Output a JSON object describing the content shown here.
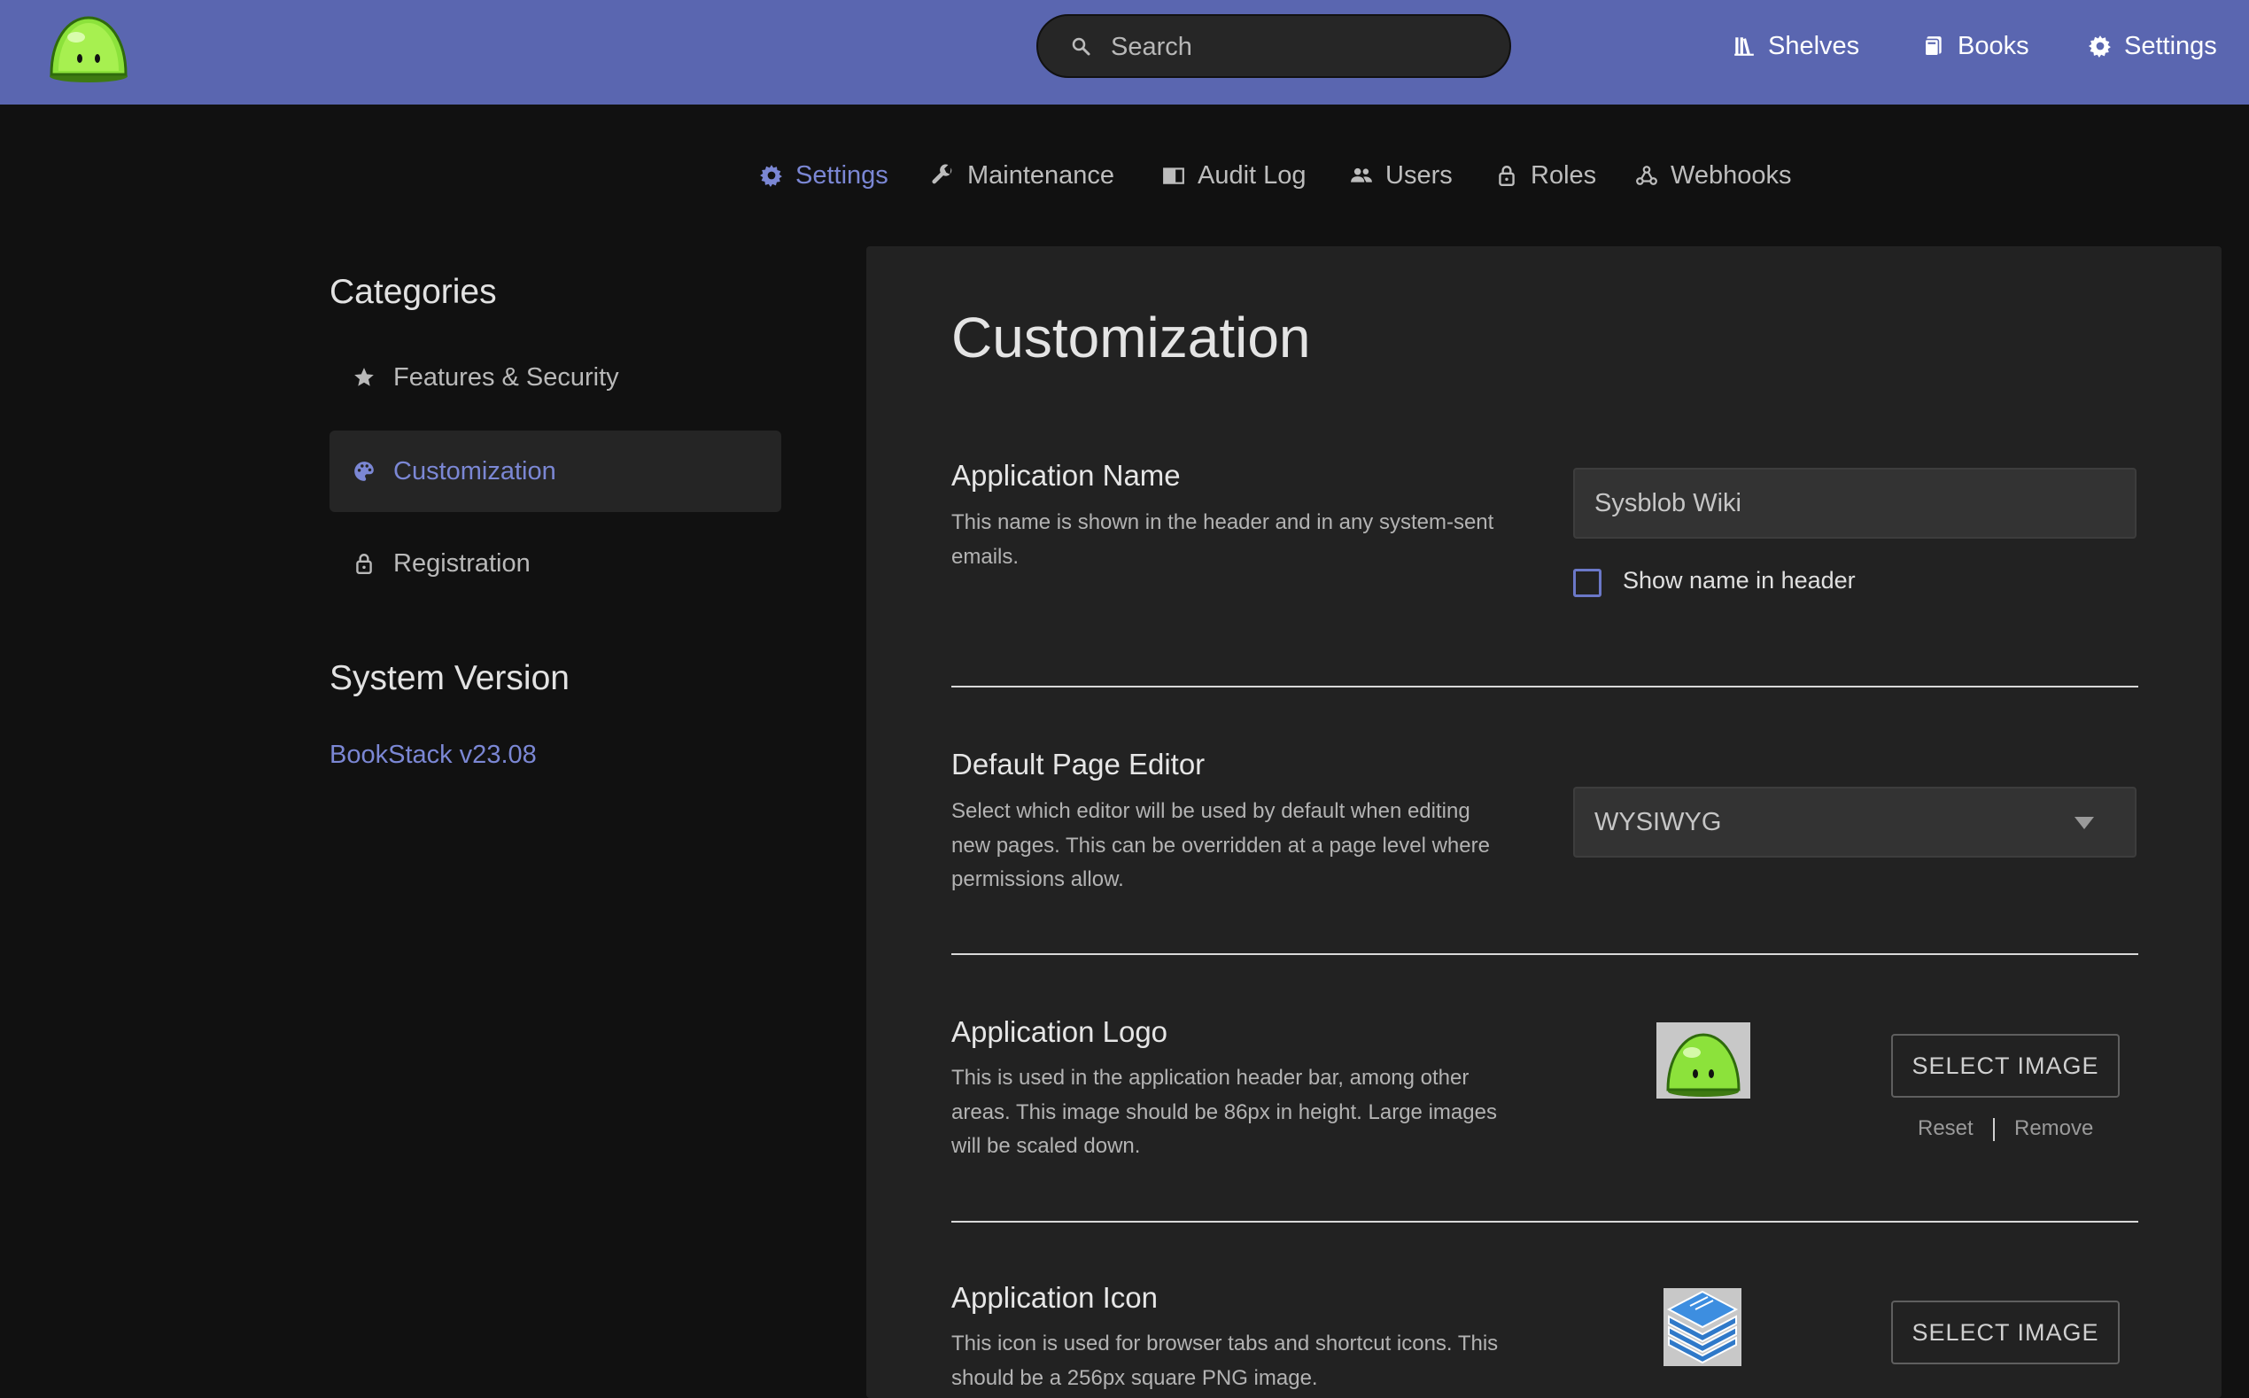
{
  "header": {
    "logo_icon": "slime-logo-icon",
    "search": {
      "placeholder": "Search"
    },
    "nav": [
      {
        "label": "Shelves",
        "icon": "shelves-icon"
      },
      {
        "label": "Books",
        "icon": "books-icon"
      },
      {
        "label": "Settings",
        "icon": "gear-icon"
      }
    ],
    "bar_color": "#5a66b0"
  },
  "settings_nav": {
    "items": [
      {
        "label": "Settings",
        "icon": "gear-icon",
        "active": true
      },
      {
        "label": "Maintenance",
        "icon": "wrench-icon"
      },
      {
        "label": "Audit Log",
        "icon": "book-open-icon"
      },
      {
        "label": "Users",
        "icon": "users-icon"
      },
      {
        "label": "Roles",
        "icon": "lock-icon"
      },
      {
        "label": "Webhooks",
        "icon": "webhook-icon"
      }
    ],
    "accent_color": "#7b87d4"
  },
  "sidebar": {
    "categories_heading": "Categories",
    "items": [
      {
        "label": "Features & Security",
        "icon": "star-icon"
      },
      {
        "label": "Customization",
        "icon": "palette-icon",
        "active": true
      },
      {
        "label": "Registration",
        "icon": "lock-icon"
      }
    ],
    "system_version_heading": "System Version",
    "version_link": "BookStack v23.08"
  },
  "main": {
    "title": "Customization",
    "app_name": {
      "title": "Application Name",
      "desc": "This name is shown in the header and in any system-sent emails.",
      "value": "Sysblob Wiki",
      "checkbox_label": "Show name in header",
      "checked": false
    },
    "editor": {
      "title": "Default Page Editor",
      "desc": "Select which editor will be used by default when editing new pages. This can be overridden at a page level where permissions allow.",
      "selected": "WYSIWYG"
    },
    "logo": {
      "title": "Application Logo",
      "desc": "This is used in the application header bar, among other areas. This image should be 86px in height. Large images will be scaled down.",
      "button": "SELECT IMAGE",
      "reset": "Reset",
      "remove": "Remove",
      "preview_icon": "slime-logo-icon"
    },
    "icon": {
      "title": "Application Icon",
      "desc": "This icon is used for browser tabs and shortcut icons. This should be a 256px square PNG image.",
      "button": "SELECT IMAGE",
      "preview_icon": "bookstack-books-icon"
    }
  }
}
